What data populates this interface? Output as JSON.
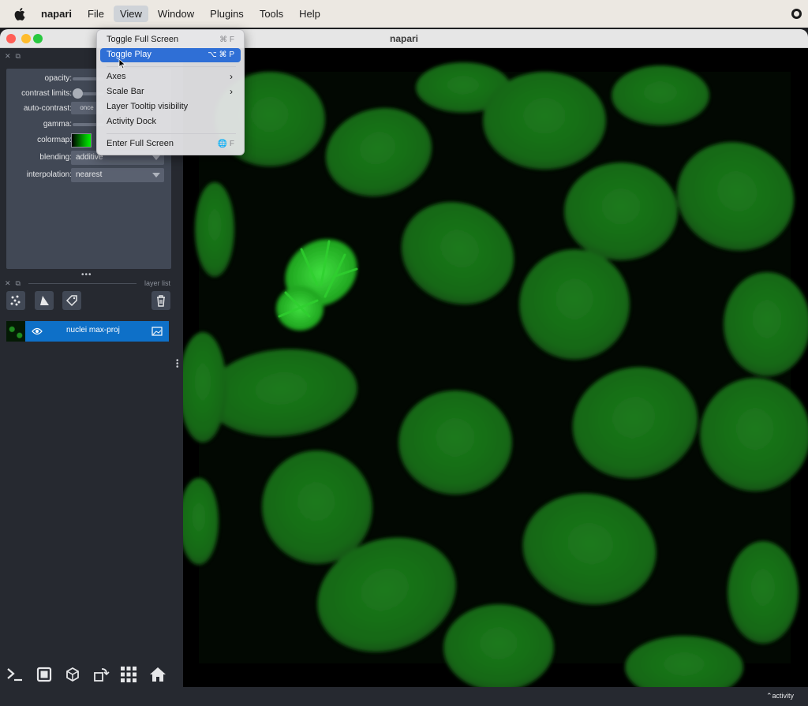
{
  "menubar": {
    "items": [
      {
        "label": "napari",
        "bold": true
      },
      {
        "label": "File"
      },
      {
        "label": "View",
        "active": true
      },
      {
        "label": "Window"
      },
      {
        "label": "Plugins"
      },
      {
        "label": "Tools"
      },
      {
        "label": "Help"
      }
    ]
  },
  "window": {
    "title": "napari"
  },
  "layer_controls": {
    "opacity_label": "opacity:",
    "contrast_label": "contrast limits:",
    "autocontrast_label": "auto-contrast:",
    "autocontrast_button": "once",
    "gamma_label": "gamma:",
    "colormap_label": "colormap:",
    "blending_label": "blending:",
    "blending_value": "additive",
    "interpolation_label": "interpolation:",
    "interpolation_value": "nearest"
  },
  "layer_list": {
    "header": "layer list",
    "layers": [
      {
        "name": "nuclei max-proj",
        "visible": true
      }
    ]
  },
  "view_menu": {
    "items": [
      {
        "label": "Toggle Full Screen",
        "shortcut": "⌘ F"
      },
      {
        "label": "Toggle Play",
        "shortcut": "⌥ ⌘ P",
        "selected": true
      },
      {
        "label": "Axes",
        "submenu": true
      },
      {
        "label": "Scale Bar",
        "submenu": true
      },
      {
        "label": "Layer Tooltip visibility"
      },
      {
        "label": "Activity Dock"
      },
      {
        "label": "Enter Full Screen",
        "shortcut": "🌐 F"
      }
    ]
  },
  "statusbar": {
    "activity_label": "activity"
  },
  "colors": {
    "accent": "#0e70c8",
    "panel": "#262930",
    "controls_bg": "#414855",
    "nuclei": "#1fa01f"
  }
}
